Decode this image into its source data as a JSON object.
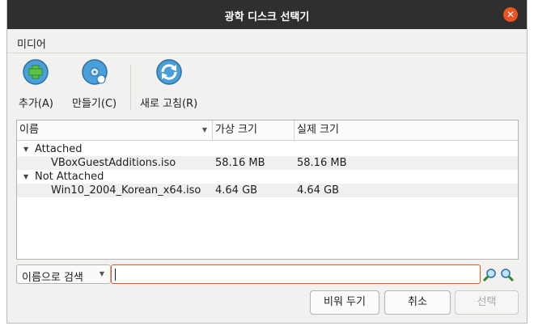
{
  "window": {
    "title": "광학 디스크 선택기"
  },
  "menubar": {
    "items": [
      "미디어"
    ]
  },
  "toolbar": {
    "add_label": "추가(A)",
    "create_label": "만들기(C)",
    "refresh_label": "새로 고침(R)"
  },
  "tree": {
    "columns": [
      "이름",
      "가상 크기",
      "실제 크기"
    ],
    "groups": [
      {
        "label": "Attached",
        "items": [
          {
            "name": "VBoxGuestAdditions.iso",
            "virtual_size": "58.16 MB",
            "actual_size": "58.16 MB"
          }
        ]
      },
      {
        "label": "Not Attached",
        "items": [
          {
            "name": "Win10_2004_Korean_x64.iso",
            "virtual_size": "4.64 GB",
            "actual_size": "4.64 GB"
          }
        ]
      }
    ]
  },
  "search": {
    "mode": "이름으로 검색",
    "value": ""
  },
  "buttons": {
    "clear": "비워 두기",
    "cancel": "취소",
    "choose": "선택"
  },
  "colors": {
    "accent": "#e95420",
    "titlebar": "#2f2f2f",
    "icon_blue": "#4a9fd8"
  }
}
